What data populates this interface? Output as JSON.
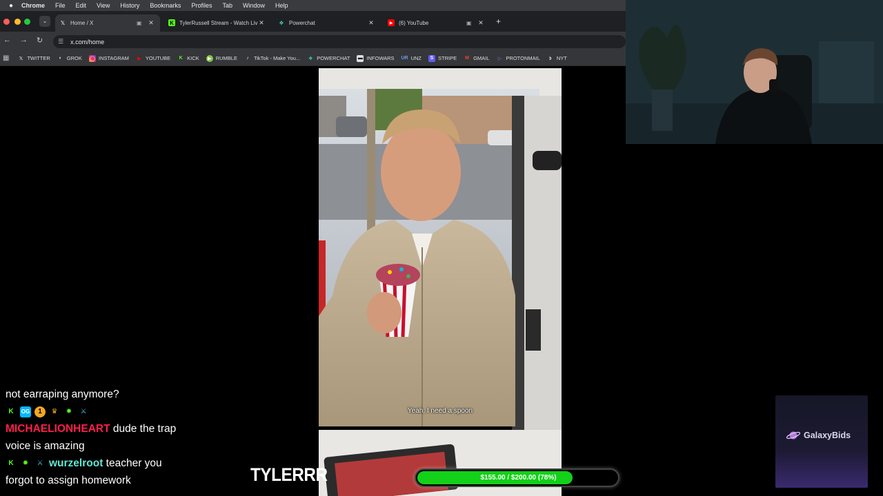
{
  "menubar": {
    "items": [
      "Chrome",
      "File",
      "Edit",
      "View",
      "History",
      "Bookmarks",
      "Profiles",
      "Tab",
      "Window",
      "Help"
    ]
  },
  "tabs": [
    {
      "title": "Home / X",
      "favicon": "x-icon",
      "active": true
    },
    {
      "title": "TylerRussell Stream - Watch Liv",
      "favicon": "kick-icon",
      "active": false
    },
    {
      "title": "Powerchat",
      "favicon": "powerchat-icon",
      "active": false
    },
    {
      "title": "(6) YouTube",
      "favicon": "youtube-icon",
      "active": false
    }
  ],
  "toolbar": {
    "url": "x.com/home"
  },
  "bookmarks": [
    {
      "label": "TWITTER",
      "icon": "x-icon",
      "color": "#ffffff"
    },
    {
      "label": "GROK",
      "icon": "grok-icon",
      "color": "#ffffff"
    },
    {
      "label": "INSTAGRAM",
      "icon": "instagram-icon",
      "color": "#e1306c"
    },
    {
      "label": "YOUTUBE",
      "icon": "youtube-icon",
      "color": "#ff0000"
    },
    {
      "label": "KICK",
      "icon": "kick-icon",
      "color": "#53fc18"
    },
    {
      "label": "RUMBLE",
      "icon": "rumble-icon",
      "color": "#85c742"
    },
    {
      "label": "TikTok - Make You...",
      "icon": "tiktok-icon",
      "color": "#ffffff"
    },
    {
      "label": "POWERCHAT",
      "icon": "powerchat-icon",
      "color": "#34d3c4"
    },
    {
      "label": "INFOWARS",
      "icon": "infowars-icon",
      "color": "#ffffff"
    },
    {
      "label": "UNZ",
      "icon": "unz-icon",
      "color": "#4a7bd8"
    },
    {
      "label": "STRIPE",
      "icon": "stripe-icon",
      "color": "#635bff"
    },
    {
      "label": "GMAIL",
      "icon": "gmail-icon",
      "color": "#ea4335"
    },
    {
      "label": "PROTONMAIL",
      "icon": "protonmail-icon",
      "color": "#8b6cf0"
    },
    {
      "label": "NYT",
      "icon": "nyt-icon",
      "color": "#ffffff"
    }
  ],
  "video": {
    "subtitle": "Yeah, I need a spoon"
  },
  "chat": {
    "lines": [
      {
        "type": "text",
        "text": "not earraping anymore?"
      },
      {
        "type": "badges"
      },
      {
        "type": "message",
        "user": "MICHAELIONHEART",
        "user_color": "#ff1f4b",
        "text": " dude the trap"
      },
      {
        "type": "text",
        "text": "voice is amazing"
      },
      {
        "type": "message_badged",
        "user": "wurzelroot",
        "user_color": "#5ee8d4",
        "text": " teacher you"
      },
      {
        "type": "text",
        "text": "forgot to assign homework"
      }
    ]
  },
  "brand": {
    "text": "TYLERRR"
  },
  "goal": {
    "text": "$155.00 / $200.00 (78%)",
    "current": 155,
    "target": 200,
    "fraction": 0.78,
    "fill_color": "#13d019"
  },
  "sponsor": {
    "name": "GalaxyBids"
  }
}
